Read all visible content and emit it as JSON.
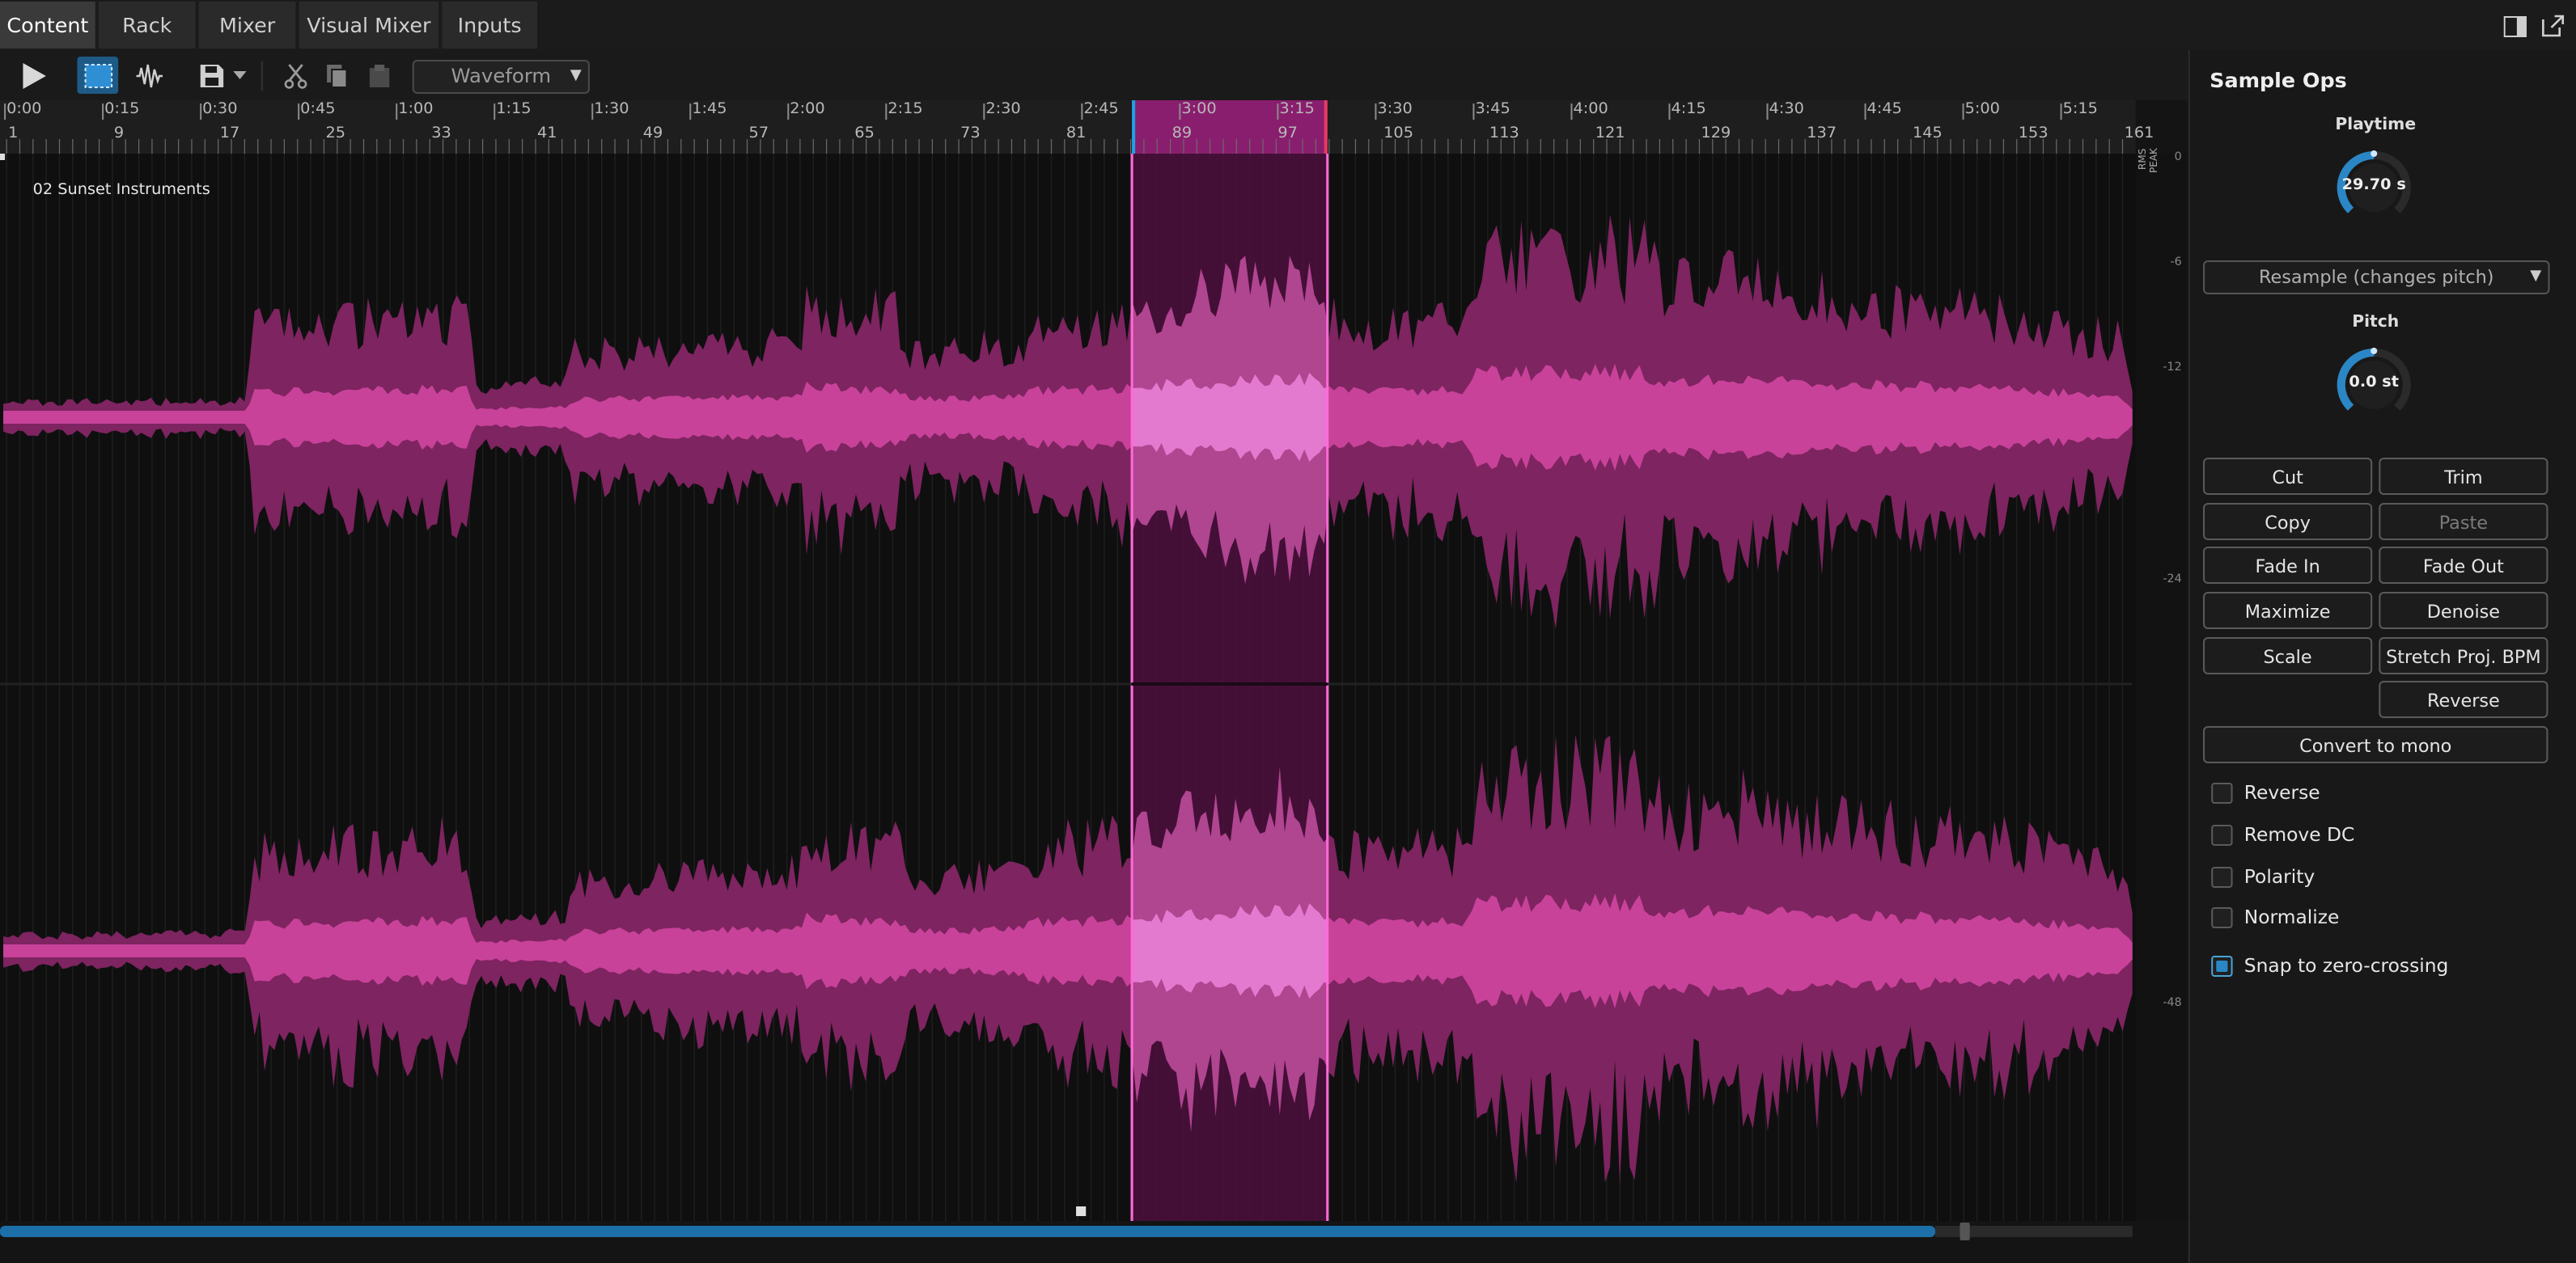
{
  "tabs": [
    {
      "label": "Content",
      "active": true
    },
    {
      "label": "Rack",
      "active": false
    },
    {
      "label": "Mixer",
      "active": false
    },
    {
      "label": "Visual Mixer",
      "active": false
    },
    {
      "label": "Inputs",
      "active": false
    }
  ],
  "toolbar": {
    "view_select": "Waveform",
    "icons": [
      "play-icon",
      "select-tool-icon",
      "waveform-tool-icon",
      "save-icon",
      "cut-icon",
      "copy-icon",
      "paste-icon"
    ]
  },
  "ruler": {
    "times": [
      "0:00",
      "0:15",
      "0:30",
      "0:45",
      "1:00",
      "1:15",
      "1:30",
      "1:45",
      "2:00",
      "2:15",
      "2:30",
      "2:45",
      "3:00",
      "3:15",
      "3:30",
      "3:45",
      "4:00",
      "4:15",
      "4:30",
      "4:45",
      "5:00",
      "5:15"
    ],
    "bars": [
      "1",
      "9",
      "17",
      "25",
      "33",
      "41",
      "49",
      "57",
      "65",
      "73",
      "81",
      "89",
      "97",
      "105",
      "113",
      "121",
      "129",
      "137",
      "145",
      "153",
      "161"
    ]
  },
  "track": {
    "name": "02 Sunset Instruments"
  },
  "meter_scale": {
    "header_top": "RMS",
    "header_bottom": "PEAK",
    "labels": [
      "0",
      "-6",
      "-12",
      "-24",
      "-48"
    ]
  },
  "panel": {
    "title": "Sample Ops",
    "playtime": {
      "label": "Playtime",
      "value": "29.70 s"
    },
    "mode_select": "Resample (changes pitch)",
    "pitch": {
      "label": "Pitch",
      "value": "0.0 st"
    },
    "buttons": {
      "cut": "Cut",
      "trim": "Trim",
      "copy": "Copy",
      "paste": "Paste",
      "fade_in": "Fade In",
      "fade_out": "Fade Out",
      "maximize": "Maximize",
      "denoise": "Denoise",
      "scale": "Scale",
      "stretch": "Stretch Proj. BPM",
      "reverse": "Reverse",
      "convert_mono": "Convert to mono"
    },
    "checkboxes": [
      {
        "label": "Reverse",
        "checked": false
      },
      {
        "label": "Remove DC",
        "checked": false
      },
      {
        "label": "Polarity",
        "checked": false
      },
      {
        "label": "Normalize",
        "checked": false
      },
      {
        "label": "Snap to zero-crossing",
        "checked": true
      }
    ]
  },
  "colors": {
    "accent": "#2b86c5",
    "waveform": "#c8429a",
    "selection": "#e040c0",
    "background": "#141414"
  }
}
